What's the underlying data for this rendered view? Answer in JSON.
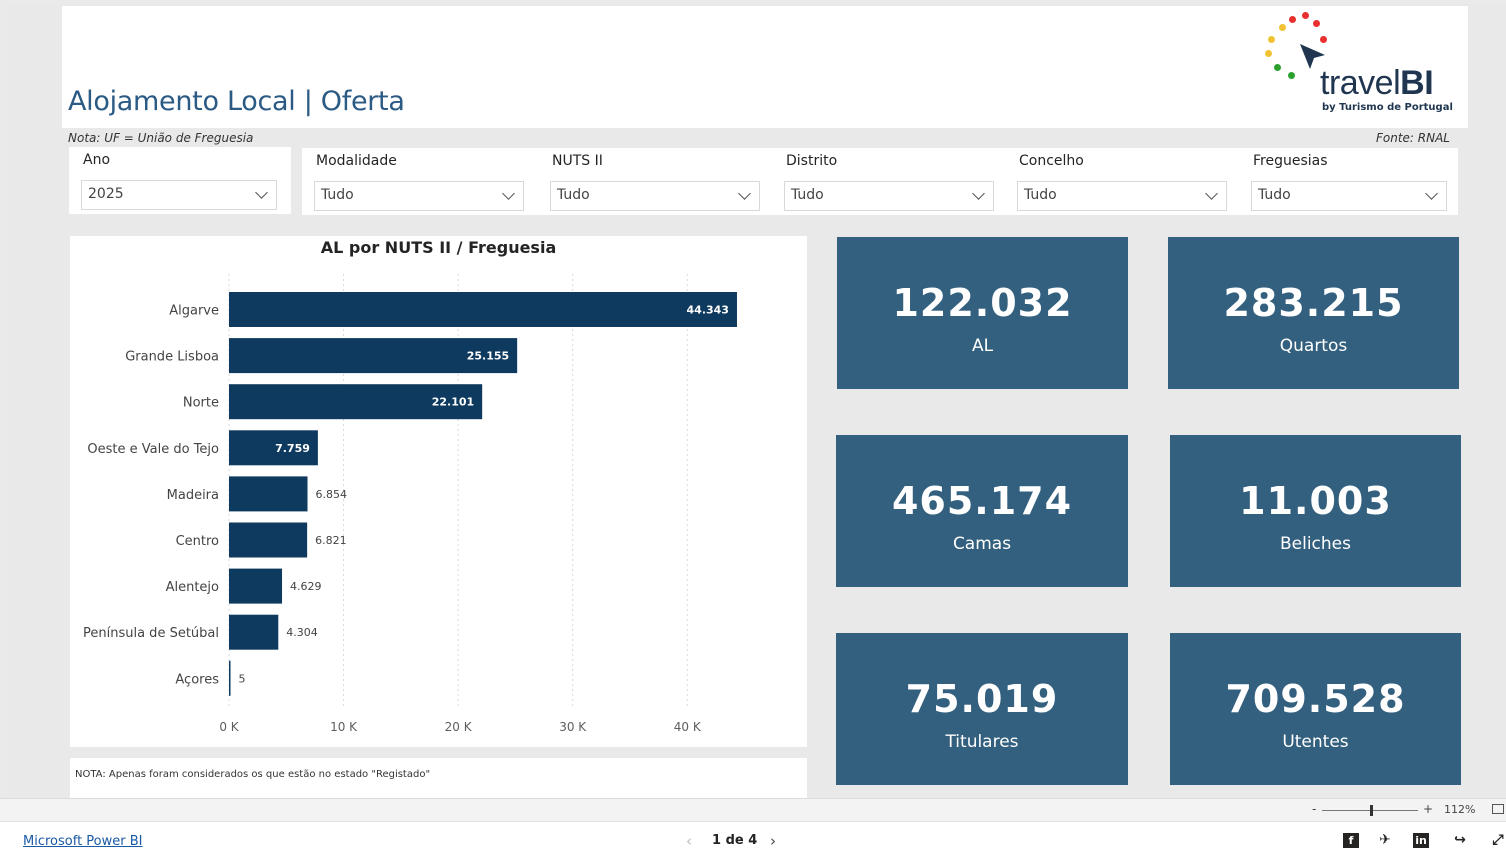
{
  "header": {
    "title": "Alojamento Local | Oferta",
    "note": "Nota: UF = União de Freguesia",
    "source": "Fonte: RNAL",
    "logo_word_light": "travel",
    "logo_word_bold": "BI",
    "logo_sub": "by Turismo de Portugal"
  },
  "slicers": [
    {
      "label": "Ano",
      "value": "2025"
    },
    {
      "label": "Modalidade",
      "value": "Tudo"
    },
    {
      "label": "NUTS II",
      "value": "Tudo"
    },
    {
      "label": "Distrito",
      "value": "Tudo"
    },
    {
      "label": "Concelho",
      "value": "Tudo"
    },
    {
      "label": "Freguesias",
      "value": "Tudo"
    }
  ],
  "chart_data": {
    "type": "bar",
    "orientation": "horizontal",
    "title": "AL por NUTS II / Freguesia",
    "categories": [
      "Algarve",
      "Grande Lisboa",
      "Norte",
      "Oeste e Vale do Tejo",
      "Madeira",
      "Centro",
      "Alentejo",
      "Península de Setúbal",
      "Açores"
    ],
    "values": [
      44343,
      25155,
      22101,
      7759,
      6854,
      6821,
      4629,
      4304,
      5
    ],
    "value_labels": [
      "44.343",
      "25.155",
      "22.101",
      "7.759",
      "6.854",
      "6.821",
      "4.629",
      "4.304",
      "5"
    ],
    "x_ticks": [
      0,
      10000,
      20000,
      30000,
      40000
    ],
    "x_tick_labels": [
      "0 K",
      "10 K",
      "20 K",
      "30 K",
      "40 K"
    ],
    "xlim": [
      0,
      45000
    ],
    "bar_color": "#0f3a5f",
    "grid": true
  },
  "chart_note": "NOTA: Apenas foram considerados os que estão no estado \"Registado\"",
  "kpis": [
    {
      "value": "122.032",
      "label": "AL"
    },
    {
      "value": "283.215",
      "label": "Quartos"
    },
    {
      "value": "465.174",
      "label": "Camas"
    },
    {
      "value": "11.003",
      "label": "Beliches"
    },
    {
      "value": "75.019",
      "label": "Titulares"
    },
    {
      "value": "709.528",
      "label": "Utentes"
    }
  ],
  "kpi_color": "#33607f",
  "status": {
    "zoom_minus": "-",
    "zoom_plus": "+",
    "zoom_level": "112%"
  },
  "footer": {
    "link": "Microsoft Power BI",
    "page_indicator": "1 de 4",
    "prev": "‹",
    "next": "›",
    "icons": [
      "facebook-icon",
      "twitter-icon",
      "linkedin-icon",
      "share-icon",
      "expand-icon"
    ]
  }
}
